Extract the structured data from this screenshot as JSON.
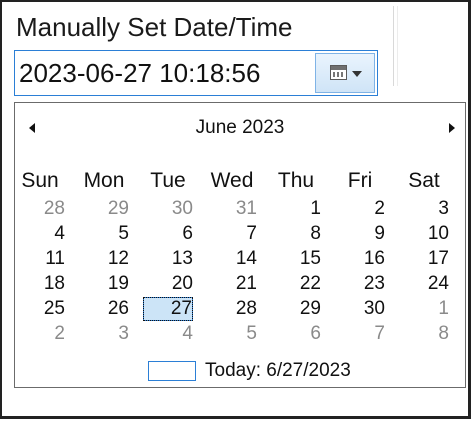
{
  "group_label": "Manually Set Date/Time",
  "datetime_value": "2023-06-27 10:18:56",
  "calendar": {
    "month_title": "June 2023",
    "day_headers": [
      "Sun",
      "Mon",
      "Tue",
      "Wed",
      "Thu",
      "Fri",
      "Sat"
    ],
    "weeks": [
      [
        {
          "d": "28",
          "other": true
        },
        {
          "d": "29",
          "other": true
        },
        {
          "d": "30",
          "other": true
        },
        {
          "d": "31",
          "other": true
        },
        {
          "d": "1"
        },
        {
          "d": "2"
        },
        {
          "d": "3"
        }
      ],
      [
        {
          "d": "4"
        },
        {
          "d": "5"
        },
        {
          "d": "6"
        },
        {
          "d": "7"
        },
        {
          "d": "8"
        },
        {
          "d": "9"
        },
        {
          "d": "10"
        }
      ],
      [
        {
          "d": "11"
        },
        {
          "d": "12"
        },
        {
          "d": "13"
        },
        {
          "d": "14"
        },
        {
          "d": "15"
        },
        {
          "d": "16"
        },
        {
          "d": "17"
        }
      ],
      [
        {
          "d": "18"
        },
        {
          "d": "19"
        },
        {
          "d": "20"
        },
        {
          "d": "21"
        },
        {
          "d": "22"
        },
        {
          "d": "23"
        },
        {
          "d": "24"
        }
      ],
      [
        {
          "d": "25"
        },
        {
          "d": "26"
        },
        {
          "d": "27",
          "selected": true
        },
        {
          "d": "28"
        },
        {
          "d": "29"
        },
        {
          "d": "30"
        },
        {
          "d": "1",
          "other": true
        }
      ],
      [
        {
          "d": "2",
          "other": true
        },
        {
          "d": "3",
          "other": true
        },
        {
          "d": "4",
          "other": true
        },
        {
          "d": "5",
          "other": true
        },
        {
          "d": "6",
          "other": true
        },
        {
          "d": "7",
          "other": true
        },
        {
          "d": "8",
          "other": true
        }
      ]
    ],
    "today_label": "Today: 6/27/2023"
  },
  "icons": {
    "prev": "triangle-left-icon",
    "next": "triangle-right-icon",
    "calendar": "calendar-icon",
    "dropdown": "chevron-down-icon"
  },
  "colors": {
    "accent": "#2b7fd6",
    "selected_fill": "#cce4f7",
    "other_month_text": "#8a8a8a"
  }
}
